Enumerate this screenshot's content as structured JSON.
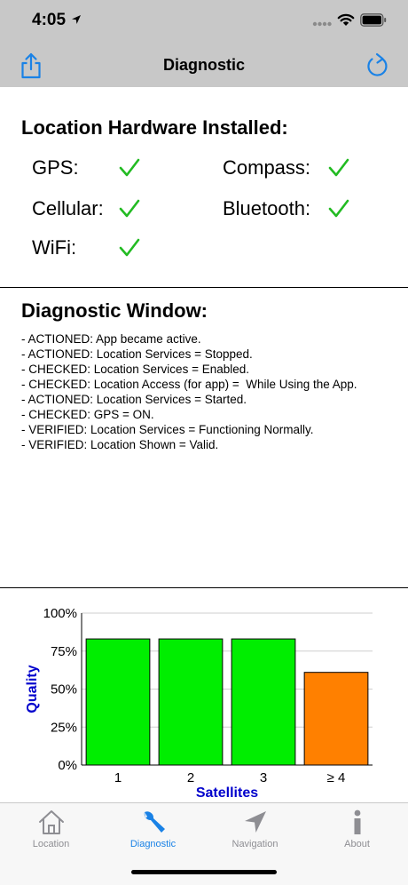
{
  "status_bar": {
    "time": "4:05"
  },
  "nav": {
    "title": "Diagnostic"
  },
  "hardware": {
    "title": "Location Hardware Installed:",
    "items": [
      {
        "label": "GPS:",
        "installed": true
      },
      {
        "label": "Compass:",
        "installed": true
      },
      {
        "label": "Cellular:",
        "installed": true
      },
      {
        "label": "Bluetooth:",
        "installed": true
      },
      {
        "label": "WiFi:",
        "installed": true
      }
    ]
  },
  "diagnostic_window": {
    "title": "Diagnostic Window:",
    "log": [
      "- ACTIONED: App became active.",
      "- ACTIONED: Location Services = Stopped.",
      "- CHECKED: Location Services = Enabled.",
      "- CHECKED: Location Access (for app) =  While Using the App.",
      "- ACTIONED: Location Services = Started.",
      "- CHECKED: GPS = ON.",
      "- VERIFIED: Location Services = Functioning Normally.",
      "- VERIFIED: Location Shown = Valid."
    ]
  },
  "chart_data": {
    "type": "bar",
    "categories": [
      "1",
      "2",
      "3",
      "≥ 4"
    ],
    "values": [
      83,
      83,
      83,
      61
    ],
    "bar_colors": [
      "#00ee00",
      "#00ee00",
      "#00ee00",
      "#ff8000"
    ],
    "xlabel": "Satellites",
    "ylabel": "Quality",
    "ylim": [
      0,
      100
    ],
    "yticks": [
      "0%",
      "25%",
      "50%",
      "75%",
      "100%"
    ],
    "grid": true,
    "axis_label_color": "#0000cc"
  },
  "tabs": [
    {
      "label": "Location",
      "icon": "house-icon",
      "active": false
    },
    {
      "label": "Diagnostic",
      "icon": "wrench-icon",
      "active": true
    },
    {
      "label": "Navigation",
      "icon": "navigation-arrow-icon",
      "active": false
    },
    {
      "label": "About",
      "icon": "info-icon",
      "active": false
    }
  ],
  "colors": {
    "accent": "#1a82e6",
    "check": "#22bb22"
  }
}
